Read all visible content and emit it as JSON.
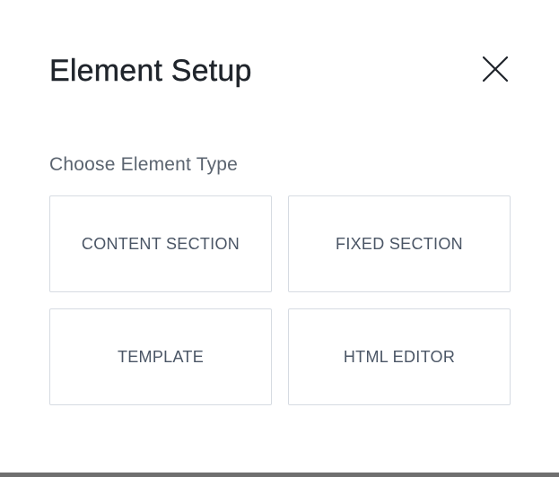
{
  "dialog": {
    "title": "Element Setup",
    "close_icon": "close-icon",
    "subtitle": "Choose Element Type",
    "options": [
      {
        "label": "CONTENT SECTION"
      },
      {
        "label": "FIXED SECTION"
      },
      {
        "label": "TEMPLATE"
      },
      {
        "label": "HTML EDITOR"
      }
    ]
  },
  "colors": {
    "title": "#1f242b",
    "subtitle": "#5b6470",
    "option_text": "#4a5565",
    "option_border": "#d6dbe2",
    "backdrop": "#6f6f6f"
  }
}
